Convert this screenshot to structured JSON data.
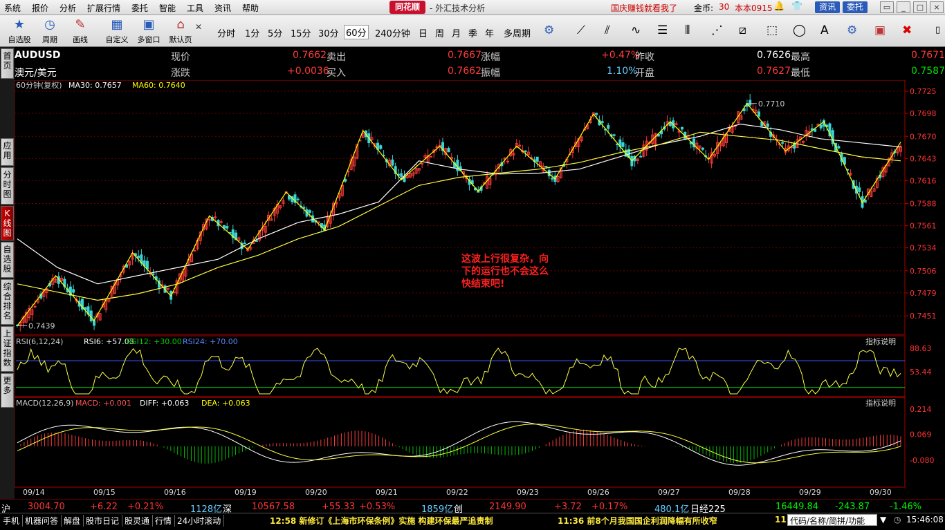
{
  "menu": [
    "系统",
    "报价",
    "分析",
    "扩展行情",
    "委托",
    "智能",
    "工具",
    "资讯",
    "帮助"
  ],
  "app": {
    "logo": "同花顺",
    "title": "- 外汇技术分析",
    "ad": "国庆赚钱就看我了",
    "gold_label": "金币:",
    "gold_value": "30",
    "version": "本本0915",
    "btn_news": "资讯",
    "btn_trade": "委托"
  },
  "toolbar": {
    "tools": [
      {
        "label": "自选股",
        "icon": "star-icon"
      },
      {
        "label": "周期",
        "icon": "clock-icon"
      },
      {
        "label": "画线",
        "icon": "pen-icon"
      },
      {
        "label": "自定义",
        "icon": "grid-icon"
      },
      {
        "label": "多窗口",
        "icon": "window-icon"
      },
      {
        "label": "默认页",
        "icon": "home-icon"
      }
    ],
    "periods": [
      "分时",
      "1分",
      "5分",
      "15分",
      "30分",
      "60分",
      "240分钟",
      "日",
      "周",
      "月",
      "季",
      "年",
      "多周期"
    ],
    "active_period": "60分"
  },
  "sidetabs": [
    "首页",
    "应用",
    "分时图",
    "K线图",
    "自选股",
    "综合排名",
    "上证指数",
    "更多"
  ],
  "quote": {
    "symbol": "AUDUSD",
    "name": "澳元/美元",
    "l_now": "现价",
    "now": "0.7662",
    "l_sell": "卖出",
    "sell": "0.7667",
    "l_chgpct": "涨幅",
    "chgpct": "+0.47%",
    "l_prev": "昨收",
    "prev": "0.7626",
    "l_high": "最高",
    "high": "0.7671",
    "l_chg": "涨跌",
    "chg": "+0.0036",
    "l_buy": "买入",
    "buy": "0.7662",
    "l_amp": "振幅",
    "amp": "1.10%",
    "l_open": "开盘",
    "open": "0.7627",
    "l_low": "最低",
    "low": "0.7587"
  },
  "main_legend": {
    "period": "60分钟(复权)",
    "ma30": "MA30: 0.7657",
    "ma60": "MA60: 0.7640"
  },
  "rsi_legend": {
    "name": "RSI(6,12,24)",
    "rsi6": "RSI6: +57.03",
    "rsi12": "RSI12: +30.00",
    "rsi24": "RSI24: +70.00",
    "help": "指标说明"
  },
  "macd_legend": {
    "name": "MACD(12,26,9)",
    "macd": "MACD: +0.001",
    "diff": "DIFF: +0.063",
    "dea": "DEA: +0.063",
    "help": "指标说明"
  },
  "annotation": "这波上行很复杂，向\n下的运行也不会这么\n快结束吧!",
  "chart_data": {
    "type": "candlestick",
    "symbol": "AUDUSD",
    "period": "60分",
    "price_axis": [
      "0.7725",
      "0.7698",
      "0.7670",
      "0.7643",
      "0.7616",
      "0.7588",
      "0.7561",
      "0.7534",
      "0.7506",
      "0.7479",
      "0.7451"
    ],
    "ylim": [
      0.743,
      0.7725
    ],
    "rsi_axis": [
      "88.63",
      "53.44"
    ],
    "macd_axis": [
      "0.214",
      "0.069",
      "-0.080"
    ],
    "dates": [
      "09/14",
      "09/15",
      "09/16",
      "09/19",
      "09/20",
      "09/21",
      "09/22",
      "09/23",
      "09/26",
      "09/27",
      "09/28",
      "09/29",
      "09/30"
    ],
    "max_marker": "0.7710",
    "min_marker": "0.7439",
    "zigzag": [
      0.7439,
      0.75,
      0.7445,
      0.7528,
      0.7475,
      0.7573,
      0.7532,
      0.7602,
      0.7556,
      0.7677,
      0.7617,
      0.7658,
      0.7603,
      0.7658,
      0.7618,
      0.7697,
      0.764,
      0.7688,
      0.7642,
      0.771,
      0.7652,
      0.7688,
      0.7589,
      0.7663
    ],
    "ma30": [
      0.7545,
      0.751,
      0.749,
      0.75,
      0.751,
      0.752,
      0.7545,
      0.7565,
      0.7575,
      0.759,
      0.764,
      0.763,
      0.7624,
      0.7625,
      0.763,
      0.7645,
      0.766,
      0.767,
      0.7685,
      0.7678,
      0.7667,
      0.7662,
      0.7657
    ],
    "ma60": [
      0.749,
      0.748,
      0.747,
      0.7478,
      0.749,
      0.751,
      0.7525,
      0.7545,
      0.756,
      0.7585,
      0.761,
      0.762,
      0.7625,
      0.763,
      0.7638,
      0.765,
      0.766,
      0.7675,
      0.767,
      0.7665,
      0.7655,
      0.7645,
      0.764
    ]
  },
  "status": {
    "sh_label": "沪",
    "sh": "3004.70",
    "sh_chg": "+6.22",
    "sh_pct": "+0.21%",
    "sh_vol": "1128亿",
    "sz_label": "深",
    "sz": "10567.58",
    "sz_chg": "+55.33",
    "sz_pct": "+0.53%",
    "sz_vol": "1859亿",
    "cy_label": "创",
    "cy": "2149.90",
    "cy_chg": "+3.72",
    "cy_pct": "+0.17%",
    "cy_vol": "480.1亿",
    "nk_label": "日经225",
    "nk": "16449.84",
    "nk_chg": "-243.87",
    "nk_pct": "-1.46%"
  },
  "bottom": {
    "tabs": [
      "手机",
      "机器问答",
      "解盘",
      "股市日记",
      "股灵通",
      "行情",
      "24小时滚动"
    ],
    "news1": "12:58 新修订《上海市环保条例》实施  构建环保最严追责制",
    "news2": "11:36 前8个月我国国企利润降幅有所收窄",
    "news3": "11:",
    "search": "代码/名称/简拼/功能",
    "clock": "15:46:08"
  }
}
